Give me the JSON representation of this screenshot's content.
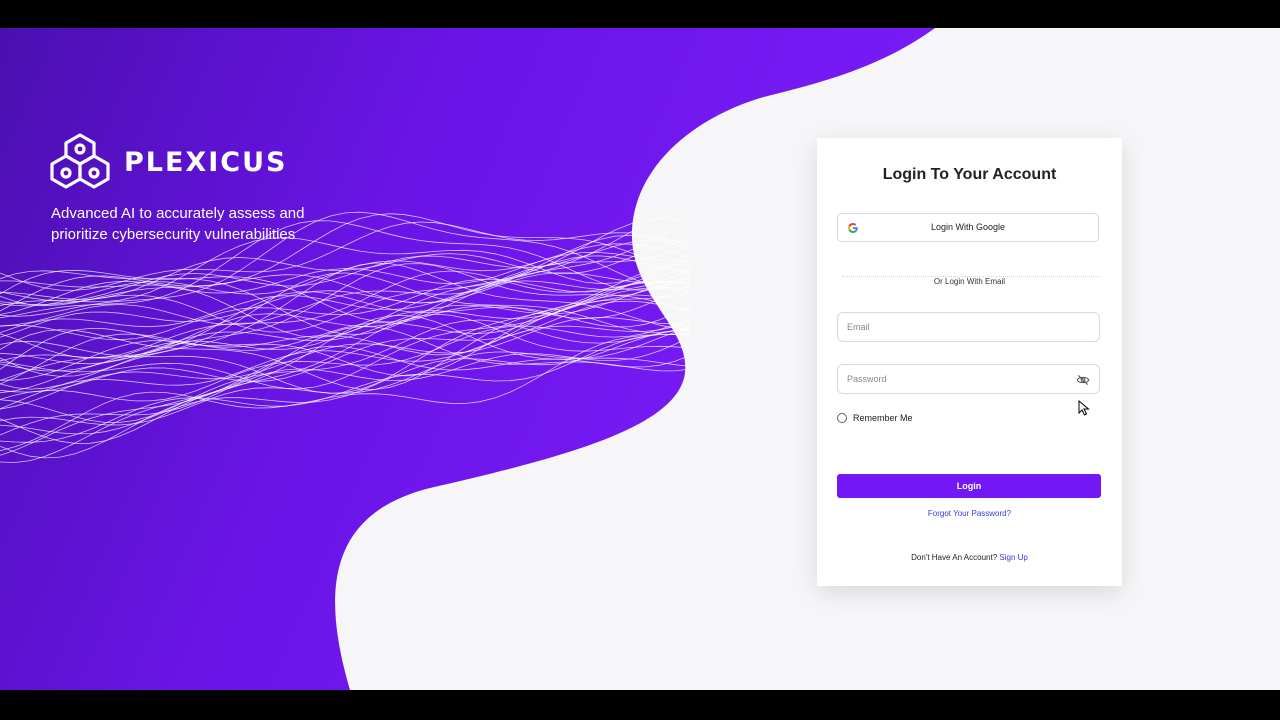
{
  "brand": {
    "name": "PLEXICUS",
    "tagline": "Advanced AI to accurately assess and prioritize cybersecurity vulnerabilities",
    "logo_icon": "network-nodes-icon"
  },
  "colors": {
    "accent": "#7417f5",
    "panel_purple": "#6a14e6",
    "link": "#3b3bd6"
  },
  "login": {
    "title": "Login To Your Account",
    "google_label": "Login With Google",
    "divider_text": "Or Login With Email",
    "email_placeholder": "Email",
    "email_value": "",
    "password_placeholder": "Password",
    "password_value": "",
    "remember_label": "Remember Me",
    "remember_checked": false,
    "submit_label": "Login",
    "forgot_label": "Forgot Your Password?",
    "signup_prompt": "Don't Have An Account?",
    "signup_label": "Sign Up"
  },
  "icons": {
    "google": "google-icon",
    "password_toggle": "eye-icon"
  }
}
